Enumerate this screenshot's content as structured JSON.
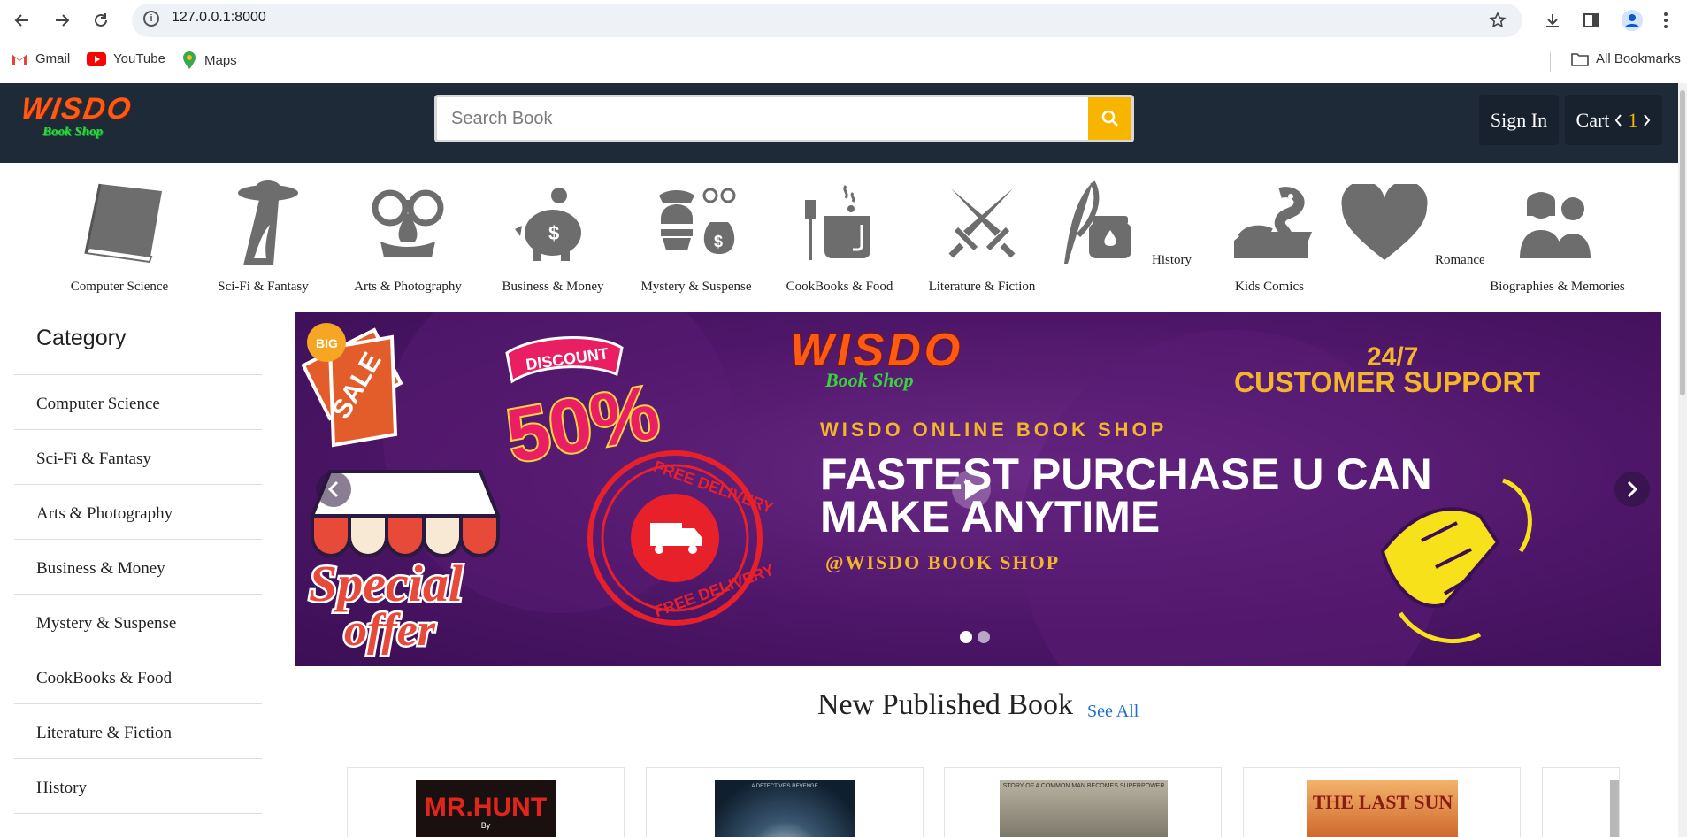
{
  "browser": {
    "url": "127.0.0.1:8000",
    "bookmarks": [
      {
        "label": "Gmail"
      },
      {
        "label": "YouTube"
      },
      {
        "label": "Maps"
      }
    ],
    "all_bookmarks": "All Bookmarks"
  },
  "header": {
    "logo_main": "WISDO",
    "logo_sub": "Book Shop",
    "search_placeholder": "Search Book",
    "signin_label": "Sign In",
    "cart_label": "Cart",
    "cart_count": "1"
  },
  "categories_bar": [
    {
      "label": "Computer Science",
      "icon": "book-icon"
    },
    {
      "label": "Sci-Fi & Fantasy",
      "icon": "ufo-icon"
    },
    {
      "label": "Arts & Photography",
      "icon": "mask-icon"
    },
    {
      "label": "Business & Money",
      "icon": "piggy-bank-icon"
    },
    {
      "label": "Mystery & Suspense",
      "icon": "detective-icon"
    },
    {
      "label": "CookBooks & Food",
      "icon": "cooking-pot-icon"
    },
    {
      "label": "Literature & Fiction",
      "icon": "crossed-swords-icon"
    },
    {
      "label": "History",
      "icon": "quill-ink-icon"
    },
    {
      "label": "Kids Comics",
      "icon": "snake-books-icon"
    },
    {
      "label": "Romance",
      "icon": "heart-icon"
    },
    {
      "label": "Biographies & Memories",
      "icon": "people-icon"
    }
  ],
  "sidebar": {
    "title": "Category",
    "items": [
      {
        "label": "Computer Science"
      },
      {
        "label": "Sci-Fi & Fantasy"
      },
      {
        "label": "Arts & Photography"
      },
      {
        "label": "Business & Money"
      },
      {
        "label": "Mystery & Suspense"
      },
      {
        "label": "CookBooks & Food"
      },
      {
        "label": "Literature & Fiction"
      },
      {
        "label": "History"
      }
    ]
  },
  "banner": {
    "big": "BIG",
    "sale": "SALE",
    "discount": "DISCOUNT",
    "percent": "50%",
    "logo_main": "WISDO",
    "logo_sub": "Book Shop",
    "support_top": "24/7",
    "support": "CUSTOMER SUPPORT",
    "tagline": "WISDO ONLINE BOOK SHOP",
    "headline_1": "FASTEST PURCHASE U CAN",
    "headline_2": "MAKE ANYTIME",
    "handle": "@WISDO BOOK SHOP",
    "special": "Special",
    "offer": "offer",
    "free_delivery": "FREE DELIVERY",
    "slides_total": 2,
    "active_slide": 1
  },
  "new_published": {
    "title": "New Published Book",
    "see_all": "See All",
    "books": [
      {
        "cover_title": "MR.HUNT",
        "cover_sub": "By"
      },
      {
        "cover_title": "",
        "cover_sub": "A DETECTIVE'S REVENGE"
      },
      {
        "cover_title": "",
        "cover_sub": "STORY OF A COMMON MAN BECOMES SUPERPOWER"
      },
      {
        "cover_title": "THE LAST SUN",
        "cover_sub": ""
      }
    ]
  },
  "colors": {
    "header_bg": "#1f2a38",
    "accent": "#f7b500",
    "banner_bg": "#4e1668",
    "link": "#1a6fcf"
  }
}
